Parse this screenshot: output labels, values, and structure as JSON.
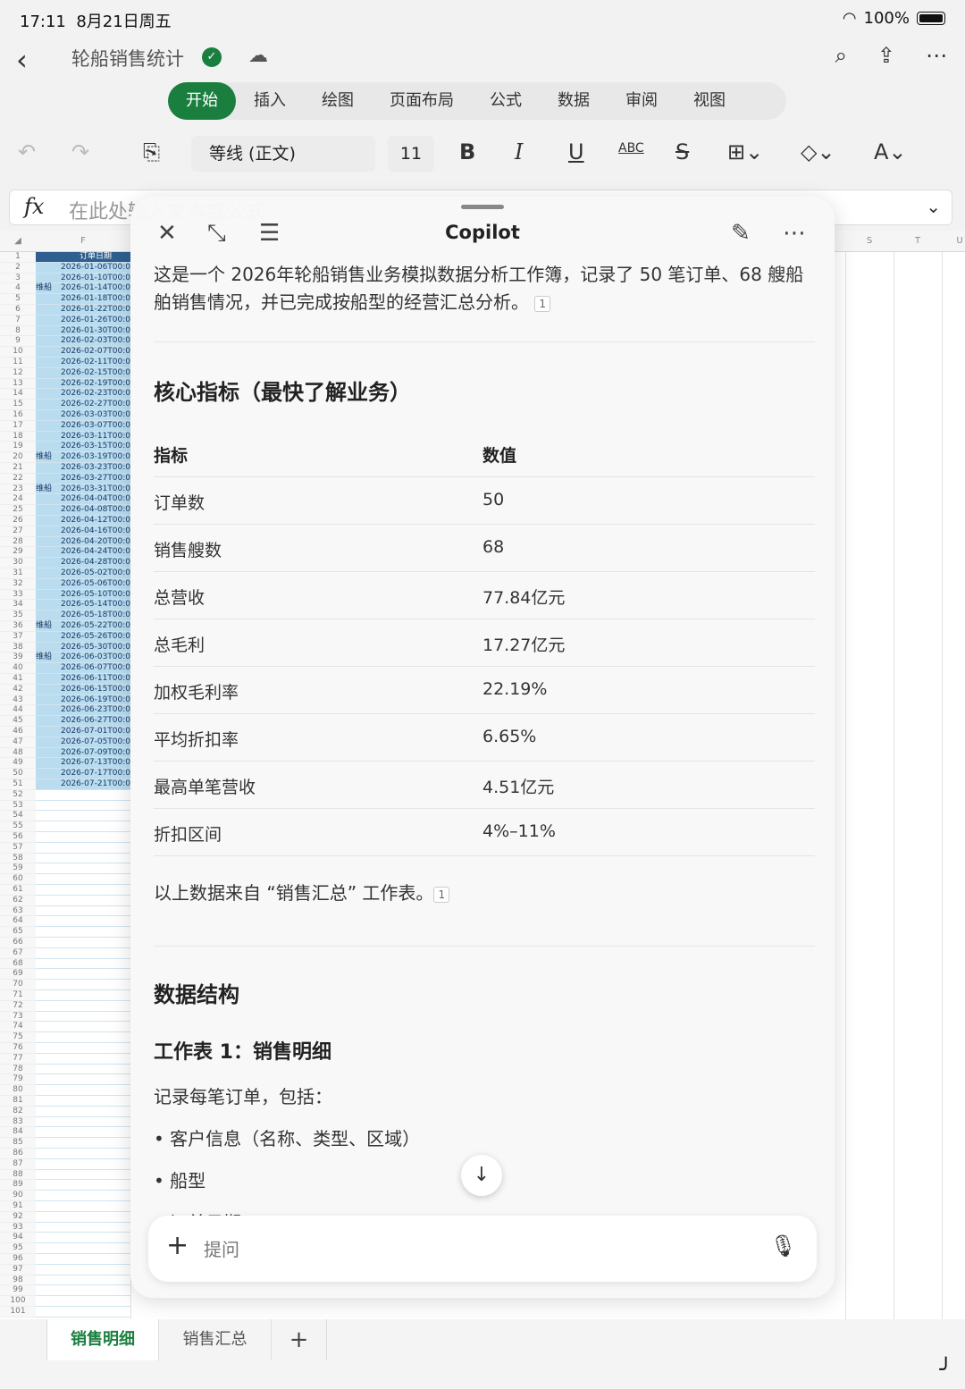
{
  "status": {
    "time": "17:11",
    "date": "8月21日周五",
    "battery": "100%"
  },
  "doc": {
    "title": "轮船销售统计"
  },
  "ribbon": {
    "tabs": [
      "开始",
      "插入",
      "绘图",
      "页面布局",
      "公式",
      "数据",
      "审阅",
      "视图"
    ],
    "active": "开始"
  },
  "toolbar": {
    "font": "等线 (正文)",
    "size": "11",
    "bold": "B",
    "italic": "I",
    "underline": "U",
    "abc": "ABC"
  },
  "formula": {
    "placeholder": "在此处输入文本或公式",
    "fx": "fx"
  },
  "sheet": {
    "col_header_f": "F",
    "right_cols": [
      "S",
      "T",
      "U"
    ],
    "header_cell": "订单日期",
    "rows_label_cells": {
      "4": "维船",
      "20": "维船",
      "23": "维船",
      "36": "维船",
      "39": "维船"
    },
    "dates": [
      "2026-01-06T00:0",
      "2026-01-10T00:0",
      "2026-01-14T00:0",
      "2026-01-18T00:0",
      "2026-01-22T00:0",
      "2026-01-26T00:0",
      "2026-01-30T00:0",
      "2026-02-03T00:0",
      "2026-02-07T00:0",
      "2026-02-11T00:0",
      "2026-02-15T00:0",
      "2026-02-19T00:0",
      "2026-02-23T00:0",
      "2026-02-27T00:0",
      "2026-03-03T00:0",
      "2026-03-07T00:0",
      "2026-03-11T00:0",
      "2026-03-15T00:0",
      "2026-03-19T00:0",
      "2026-03-23T00:0",
      "2026-03-27T00:0",
      "2026-03-31T00:0",
      "2026-04-04T00:0",
      "2026-04-08T00:0",
      "2026-04-12T00:0",
      "2026-04-16T00:0",
      "2026-04-20T00:0",
      "2026-04-24T00:0",
      "2026-04-28T00:0",
      "2026-05-02T00:0",
      "2026-05-06T00:0",
      "2026-05-10T00:0",
      "2026-05-14T00:0",
      "2026-05-18T00:0",
      "2026-05-22T00:0",
      "2026-05-26T00:0",
      "2026-05-30T00:0",
      "2026-06-03T00:0",
      "2026-06-07T00:0",
      "2026-06-11T00:0",
      "2026-06-15T00:0",
      "2026-06-19T00:0",
      "2026-06-23T00:0",
      "2026-06-27T00:0",
      "2026-07-01T00:0",
      "2026-07-05T00:0",
      "2026-07-09T00:0",
      "2026-07-13T00:0",
      "2026-07-17T00:0",
      "2026-07-21T00:0"
    ],
    "row_count": 101
  },
  "copilot": {
    "title": "Copilot",
    "intro": "这是一个 2026年轮船销售业务模拟数据分析工作簿，记录了 50 笔订单、68 艘船舶销售情况，并已完成按船型的经营汇总分析。",
    "cite": "1",
    "section1": "核心指标（最快了解业务）",
    "table_head": [
      "指标",
      "数值"
    ],
    "metrics": [
      {
        "name": "订单数",
        "value": "50"
      },
      {
        "name": "销售艘数",
        "value": "68"
      },
      {
        "name": "总营收",
        "value": "77.84亿元"
      },
      {
        "name": "总毛利",
        "value": "17.27亿元"
      },
      {
        "name": "加权毛利率",
        "value": "22.19%"
      },
      {
        "name": "平均折扣率",
        "value": "6.65%"
      },
      {
        "name": "最高单笔营收",
        "value": "4.51亿元"
      },
      {
        "name": "折扣区间",
        "value": "4%–11%"
      }
    ],
    "source_note": "以上数据来自 “销售汇总” 工作表。",
    "section2": "数据结构",
    "sub1": "工作表 1：销售明细",
    "sub1_desc": "记录每笔订单，包括：",
    "bullets": [
      "• 客户信息（名称、类型、区域）",
      "• 船型",
      "• 订单日期"
    ],
    "ask_placeholder": "提问"
  },
  "sheet_tabs": [
    "销售明细",
    "销售汇总",
    "+"
  ]
}
